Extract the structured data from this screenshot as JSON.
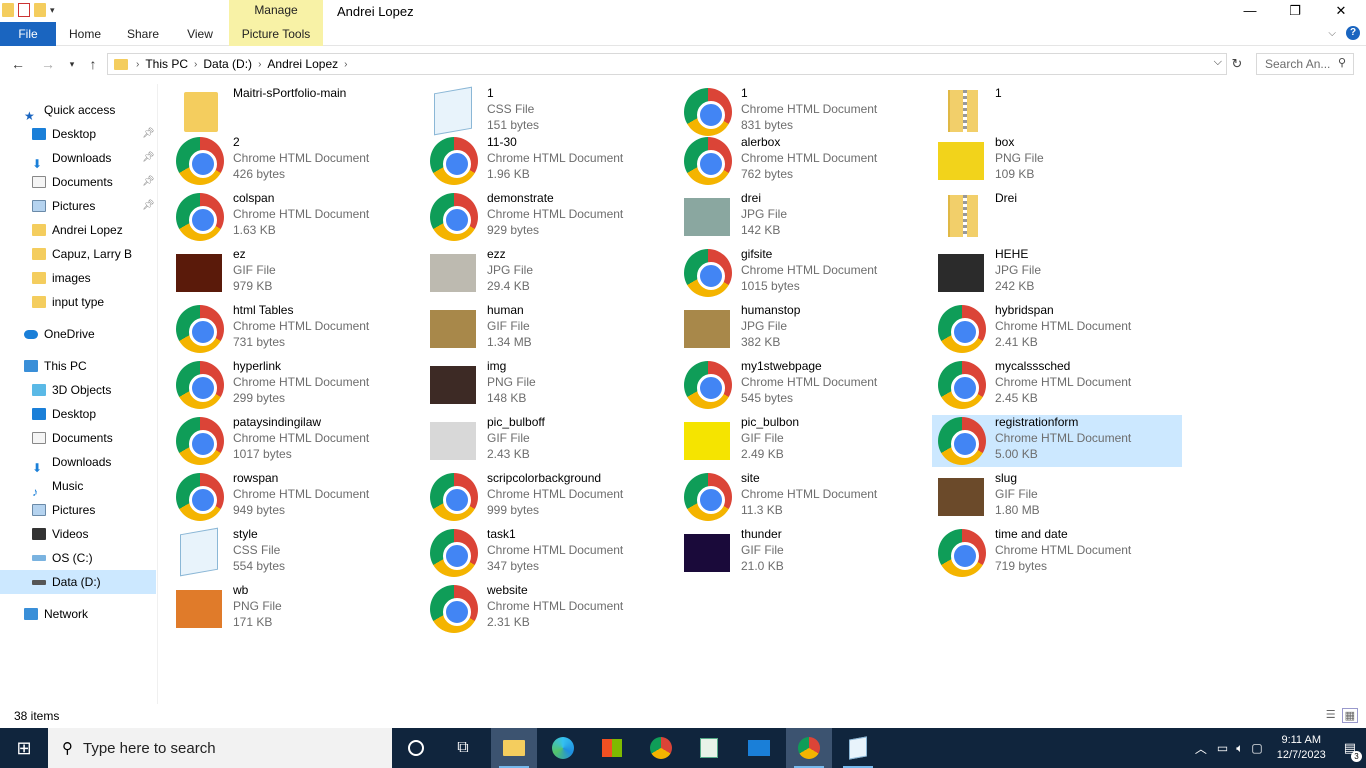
{
  "window": {
    "title": "Andrei Lopez",
    "manage_label": "Manage",
    "minimize": "—",
    "maximize": "❐",
    "close": "✕"
  },
  "ribbon": {
    "tabs": [
      "File",
      "Home",
      "Share",
      "View",
      "Picture Tools"
    ]
  },
  "address": {
    "crumbs": [
      "This PC",
      "Data (D:)",
      "Andrei Lopez"
    ],
    "search_placeholder": "Search An..."
  },
  "nav": {
    "items": [
      {
        "label": "Quick access",
        "icon": "star-icon"
      },
      {
        "label": "Desktop",
        "icon": "desktop-icon",
        "pinned": true
      },
      {
        "label": "Downloads",
        "icon": "download-icon",
        "pinned": true
      },
      {
        "label": "Documents",
        "icon": "documents-icon",
        "pinned": true
      },
      {
        "label": "Pictures",
        "icon": "pictures-icon",
        "pinned": true
      },
      {
        "label": "Andrei Lopez",
        "icon": "folder-icon"
      },
      {
        "label": "Capuz, Larry B",
        "icon": "folder-icon"
      },
      {
        "label": "images",
        "icon": "folder-icon"
      },
      {
        "label": "input type",
        "icon": "folder-icon"
      },
      {
        "label": "OneDrive",
        "icon": "cloud-icon"
      },
      {
        "label": "This PC",
        "icon": "computer-icon"
      },
      {
        "label": "3D Objects",
        "icon": "cube-icon"
      },
      {
        "label": "Desktop",
        "icon": "desktop-icon"
      },
      {
        "label": "Documents",
        "icon": "documents-icon"
      },
      {
        "label": "Downloads",
        "icon": "download-icon"
      },
      {
        "label": "Music",
        "icon": "music-icon"
      },
      {
        "label": "Pictures",
        "icon": "pictures-icon"
      },
      {
        "label": "Videos",
        "icon": "videos-icon"
      },
      {
        "label": "OS (C:)",
        "icon": "drive-icon"
      },
      {
        "label": "Data (D:)",
        "icon": "drive-icon"
      },
      {
        "label": "Network",
        "icon": "network-icon"
      }
    ]
  },
  "files": [
    {
      "name": "Maitri-sPortfolio-main",
      "type": "",
      "size": "",
      "icon": "folder"
    },
    {
      "name": "1",
      "type": "CSS File",
      "size": "151 bytes",
      "icon": "notepad"
    },
    {
      "name": "1",
      "type": "Chrome HTML Document",
      "size": "831 bytes",
      "icon": "chrome"
    },
    {
      "name": "1",
      "type": "",
      "size": "",
      "icon": "zip"
    },
    {
      "name": "2",
      "type": "Chrome HTML Document",
      "size": "426 bytes",
      "icon": "chrome"
    },
    {
      "name": "11-30",
      "type": "Chrome HTML Document",
      "size": "1.96 KB",
      "icon": "chrome"
    },
    {
      "name": "alerbox",
      "type": "Chrome HTML Document",
      "size": "762 bytes",
      "icon": "chrome"
    },
    {
      "name": "box",
      "type": "PNG File",
      "size": "109 KB",
      "icon": "image",
      "color": "#f2d31b"
    },
    {
      "name": "colspan",
      "type": "Chrome HTML Document",
      "size": "1.63 KB",
      "icon": "chrome"
    },
    {
      "name": "demonstrate",
      "type": "Chrome HTML Document",
      "size": "929 bytes",
      "icon": "chrome"
    },
    {
      "name": "drei",
      "type": "JPG File",
      "size": "142 KB",
      "icon": "image",
      "color": "#8aa7a0"
    },
    {
      "name": "Drei",
      "type": "",
      "size": "",
      "icon": "zip"
    },
    {
      "name": "ez",
      "type": "GIF File",
      "size": "979 KB",
      "icon": "image",
      "color": "#5a1a0a"
    },
    {
      "name": "ezz",
      "type": "JPG File",
      "size": "29.4 KB",
      "icon": "image",
      "color": "#bdbab0"
    },
    {
      "name": "gifsite",
      "type": "Chrome HTML Document",
      "size": "1015 bytes",
      "icon": "chrome"
    },
    {
      "name": "HEHE",
      "type": "JPG File",
      "size": "242 KB",
      "icon": "image",
      "color": "#2b2b2b"
    },
    {
      "name": "html Tables",
      "type": "Chrome HTML Document",
      "size": "731 bytes",
      "icon": "chrome"
    },
    {
      "name": "human",
      "type": "GIF File",
      "size": "1.34 MB",
      "icon": "image",
      "color": "#a8884a"
    },
    {
      "name": "humanstop",
      "type": "JPG File",
      "size": "382 KB",
      "icon": "image",
      "color": "#a8884a"
    },
    {
      "name": "hybridspan",
      "type": "Chrome HTML Document",
      "size": "2.41 KB",
      "icon": "chrome"
    },
    {
      "name": "hyperlink",
      "type": "Chrome HTML Document",
      "size": "299 bytes",
      "icon": "chrome"
    },
    {
      "name": "img",
      "type": "PNG File",
      "size": "148 KB",
      "icon": "image",
      "color": "#3d2a25"
    },
    {
      "name": "my1stwebpage",
      "type": "Chrome HTML Document",
      "size": "545 bytes",
      "icon": "chrome"
    },
    {
      "name": "mycalsssched",
      "type": "Chrome HTML Document",
      "size": "2.45 KB",
      "icon": "chrome"
    },
    {
      "name": "pataysindingilaw",
      "type": "Chrome HTML Document",
      "size": "1017 bytes",
      "icon": "chrome"
    },
    {
      "name": "pic_bulboff",
      "type": "GIF File",
      "size": "2.43 KB",
      "icon": "image",
      "color": "#d8d8d8"
    },
    {
      "name": "pic_bulbon",
      "type": "GIF File",
      "size": "2.49 KB",
      "icon": "image",
      "color": "#f5e400"
    },
    {
      "name": "registrationform",
      "type": "Chrome HTML Document",
      "size": "5.00 KB",
      "icon": "chrome",
      "selected": true
    },
    {
      "name": "rowspan",
      "type": "Chrome HTML Document",
      "size": "949 bytes",
      "icon": "chrome"
    },
    {
      "name": "scripcolorbackground",
      "type": "Chrome HTML Document",
      "size": "999 bytes",
      "icon": "chrome"
    },
    {
      "name": "site",
      "type": "Chrome HTML Document",
      "size": "11.3 KB",
      "icon": "chrome"
    },
    {
      "name": "slug",
      "type": "GIF File",
      "size": "1.80 MB",
      "icon": "image",
      "color": "#6b4a2a"
    },
    {
      "name": "style",
      "type": "CSS File",
      "size": "554 bytes",
      "icon": "notepad"
    },
    {
      "name": "task1",
      "type": "Chrome HTML Document",
      "size": "347 bytes",
      "icon": "chrome"
    },
    {
      "name": "thunder",
      "type": "GIF File",
      "size": "21.0 KB",
      "icon": "image",
      "color": "#1a0a3a"
    },
    {
      "name": "time and date",
      "type": "Chrome HTML Document",
      "size": "719 bytes",
      "icon": "chrome"
    },
    {
      "name": "wb",
      "type": "PNG File",
      "size": "171 KB",
      "icon": "image",
      "color": "#e07b2a"
    },
    {
      "name": "website",
      "type": "Chrome HTML Document",
      "size": "2.31 KB",
      "icon": "chrome"
    }
  ],
  "status": {
    "items_count": "38 items"
  },
  "taskbar": {
    "search_placeholder": "Type here to search",
    "time": "9:11 AM",
    "date": "12/7/2023",
    "notification_count": "3"
  }
}
